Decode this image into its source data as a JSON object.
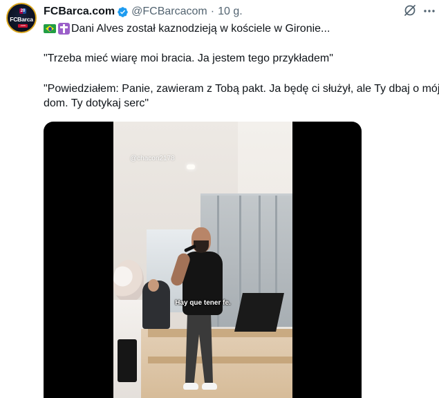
{
  "account": {
    "display_name": "FCBarca.com",
    "handle": "@FCBarcacom",
    "separator": "·",
    "timestamp": "10 g.",
    "verified": true,
    "avatar_brand": "FCBarca",
    "avatar_badge": "20",
    "avatar_sub": ".com"
  },
  "tweet": {
    "line1_text": "Dani Alves został kaznodzieją w kościele w Gironie...",
    "emoji": [
      "brazil-flag",
      "latin-cross"
    ],
    "para2": "\"Trzeba mieć wiarę moi bracia. Ja jestem tego przykładem\"",
    "para3": "\"Powiedziałem: Panie, zawieram z Tobą pakt. Ja będę ci służył, ale Ty dbaj o mój dom. Ty dotykaj serc\""
  },
  "media": {
    "watermark": "@chacon2178",
    "caption": "Hay que tener fe."
  },
  "icons": {
    "verified": "verified-badge-icon",
    "grok": "grok-icon",
    "more": "more-options-icon"
  },
  "colors": {
    "text_primary": "#0f1419",
    "text_secondary": "#536471",
    "verified_blue": "#1d9bf0"
  }
}
